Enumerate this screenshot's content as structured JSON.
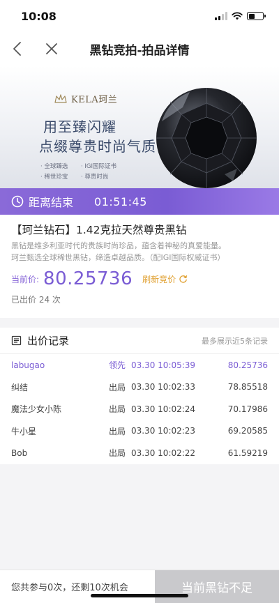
{
  "status_bar": {
    "time": "10:08"
  },
  "nav": {
    "title": "黑钻竞拍-拍品详情"
  },
  "banner": {
    "brand": "KELA珂兰",
    "line1": "用至臻闪耀",
    "line2": "点缀尊贵时尚气质",
    "tags": [
      "· 全球臻选",
      "· IGI国际证书",
      "· 稀世珍宝",
      "· 尊贵时尚"
    ]
  },
  "countdown": {
    "label": "距离结束",
    "time": "01:51:45"
  },
  "product": {
    "title": "【珂兰钻石】1.42克拉天然尊贵黑钻",
    "desc_line1": "黑钻是维多利亚时代的贵族时尚珍品，蕴含着神秘的真爱能量。",
    "desc_line2": "珂兰甄选全球稀世黑钻，缔造卓越品质。（配IGI国际权威证书）",
    "price_label": "当前价:",
    "price": "80.25736",
    "refresh_label": "刷新竞价",
    "bids_count": "已出价 24 次"
  },
  "records": {
    "title": "出价记录",
    "note": "最多展示近5条记录",
    "rows": [
      {
        "name": "labugao",
        "status": "领先",
        "time": "03.30 10:05:39",
        "price": "80.25736"
      },
      {
        "name": "纠结",
        "status": "出局",
        "time": "03.30 10:02:33",
        "price": "78.85518"
      },
      {
        "name": "魔法少女小陈",
        "status": "出局",
        "time": "03.30 10:02:24",
        "price": "70.17986"
      },
      {
        "name": "牛小星",
        "status": "出局",
        "time": "03.30 10:02:23",
        "price": "69.20585"
      },
      {
        "name": "Bob",
        "status": "出局",
        "time": "03.30 10:02:22",
        "price": "61.59219"
      }
    ]
  },
  "bottom": {
    "info": "您共参与0次，还剩10次机会",
    "button": "当前黑钻不足"
  },
  "colors": {
    "accent": "#7a5cd4",
    "refresh": "#e0a030",
    "disabled_button": "#c9c9cc"
  }
}
